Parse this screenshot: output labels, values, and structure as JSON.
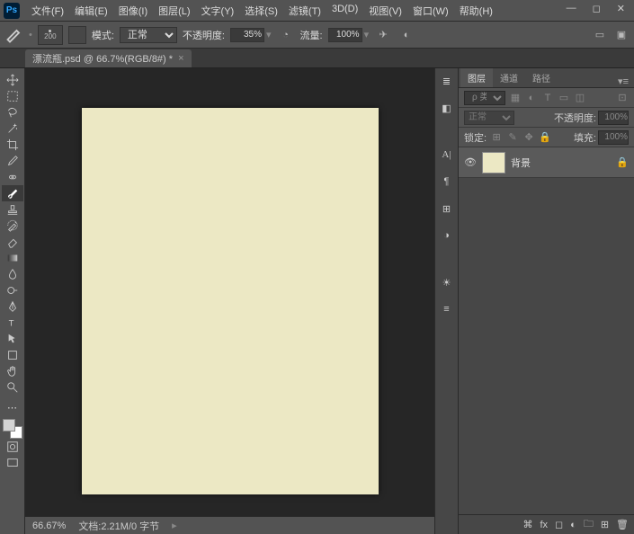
{
  "app": {
    "logo": "Ps"
  },
  "menu": [
    "文件(F)",
    "编辑(E)",
    "图像(I)",
    "图层(L)",
    "文字(Y)",
    "选择(S)",
    "滤镜(T)",
    "3D(D)",
    "视图(V)",
    "窗口(W)",
    "帮助(H)"
  ],
  "options": {
    "brush_size": "200",
    "mode_label": "模式:",
    "mode_value": "正常",
    "opacity_label": "不透明度:",
    "opacity_value": "35%",
    "flow_label": "流量:",
    "flow_value": "100%"
  },
  "document": {
    "tab_title": "漂流瓶.psd @ 66.7%(RGB/8#) *",
    "zoom": "66.67%",
    "status": "文档:2.21M/0 字节"
  },
  "panels": {
    "tabs": [
      "图层",
      "通道",
      "路径"
    ],
    "kind_label": "ρ 类型",
    "blend_value": "正常",
    "opacity_label": "不透明度:",
    "opacity_value": "100%",
    "lock_label": "锁定:",
    "fill_label": "填充:",
    "fill_value": "100%"
  },
  "layers": [
    {
      "name": "背景",
      "locked": true,
      "visible": true
    }
  ]
}
